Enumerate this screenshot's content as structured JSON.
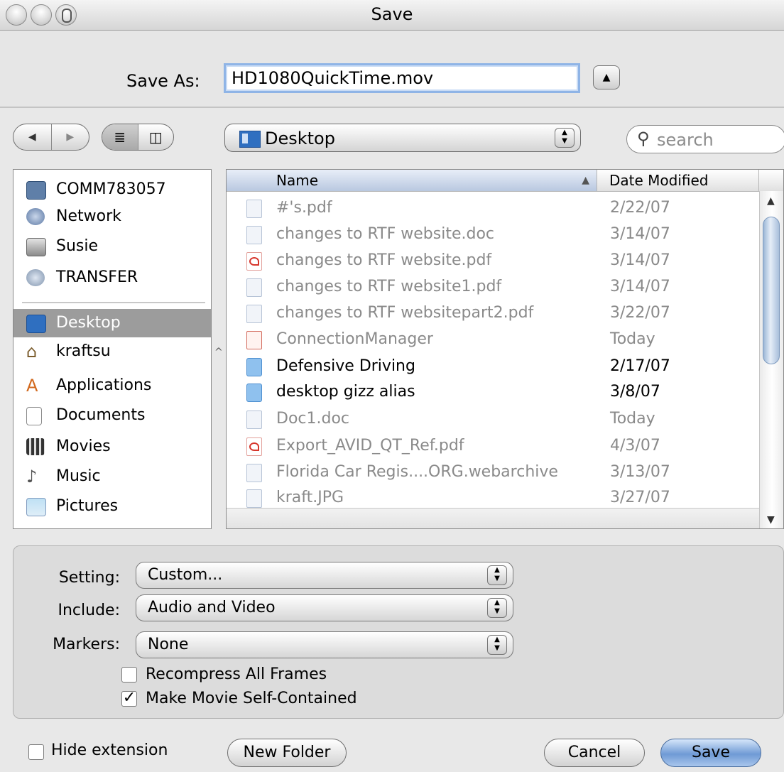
{
  "window": {
    "title": "Save"
  },
  "save_as": {
    "label": "Save As:",
    "value": "HD1080QuickTime.mov"
  },
  "toolbar": {
    "location": "Desktop",
    "search_placeholder": "search"
  },
  "sidebar": {
    "devices": [
      {
        "label": "COMM783057",
        "icon": "computer-icon"
      },
      {
        "label": "Network",
        "icon": "network-icon"
      },
      {
        "label": "Susie",
        "icon": "hard-drive-icon"
      },
      {
        "label": "TRANSFER",
        "icon": "disk-icon"
      }
    ],
    "places": [
      {
        "label": "Desktop",
        "icon": "desktop-icon",
        "selected": true
      },
      {
        "label": "kraftsu",
        "icon": "home-icon"
      },
      {
        "label": "Applications",
        "icon": "applications-icon"
      },
      {
        "label": "Documents",
        "icon": "documents-icon"
      },
      {
        "label": "Movies",
        "icon": "movies-icon"
      },
      {
        "label": "Music",
        "icon": "music-icon"
      },
      {
        "label": "Pictures",
        "icon": "pictures-icon"
      }
    ]
  },
  "file_list": {
    "columns": {
      "name": "Name",
      "date": "Date Modified"
    },
    "rows": [
      {
        "name": "#'s.pdf",
        "date": "2/22/07",
        "icon": "image-file-icon",
        "enabled": false
      },
      {
        "name": "changes to RTF website.doc",
        "date": "3/14/07",
        "icon": "document-file-icon",
        "enabled": false
      },
      {
        "name": "changes to RTF website.pdf",
        "date": "3/14/07",
        "icon": "pdf-file-icon",
        "enabled": false
      },
      {
        "name": "changes to RTF website1.pdf",
        "date": "3/14/07",
        "icon": "document-file-icon",
        "enabled": false
      },
      {
        "name": "changes to RTF websitepart2.pdf",
        "date": "3/22/07",
        "icon": "document-file-icon",
        "enabled": false
      },
      {
        "name": "ConnectionManager",
        "date": "Today",
        "icon": "application-icon",
        "enabled": false
      },
      {
        "name": "Defensive Driving",
        "date": "2/17/07",
        "icon": "folder-icon",
        "enabled": true
      },
      {
        "name": "desktop gizz alias",
        "date": "3/8/07",
        "icon": "folder-alias-icon",
        "enabled": true
      },
      {
        "name": "Doc1.doc",
        "date": "Today",
        "icon": "document-file-icon",
        "enabled": false
      },
      {
        "name": "Export_AVID_QT_Ref.pdf",
        "date": "4/3/07",
        "icon": "pdf-file-icon",
        "enabled": false
      },
      {
        "name": "Florida Car Regis....ORG.webarchive",
        "date": "3/13/07",
        "icon": "webarchive-file-icon",
        "enabled": false
      },
      {
        "name": "kraft.JPG",
        "date": "3/27/07",
        "icon": "image-file-icon",
        "enabled": false
      }
    ]
  },
  "options": {
    "setting": {
      "label": "Setting:",
      "value": "Custom..."
    },
    "include": {
      "label": "Include:",
      "value": "Audio and Video"
    },
    "markers": {
      "label": "Markers:",
      "value": "None"
    },
    "recompress": {
      "label": "Recompress All Frames",
      "checked": false
    },
    "self_contained": {
      "label": "Make Movie Self-Contained",
      "checked": true
    }
  },
  "footer": {
    "hide_extension": {
      "label": "Hide extension",
      "checked": false
    },
    "new_folder": "New Folder",
    "cancel": "Cancel",
    "save": "Save"
  }
}
